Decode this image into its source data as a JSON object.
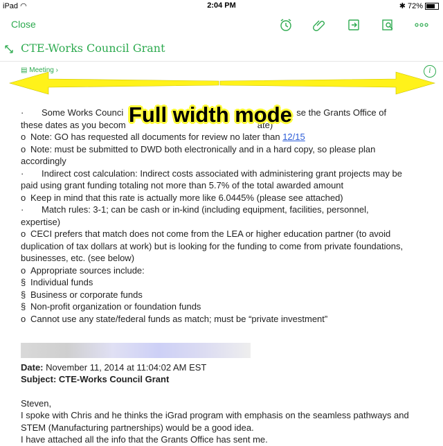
{
  "status": {
    "carrier": "iPad",
    "time": "2:04 PM",
    "battery": "72%"
  },
  "toolbar": {
    "close_label": "Close",
    "icons": [
      "alarm-clock-icon",
      "paperclip-icon",
      "share-icon",
      "presentation-icon",
      "more-icon"
    ]
  },
  "note": {
    "title": "CTE-Works Council Grant",
    "notebook": "Meeting"
  },
  "overlay": {
    "banner": "Full width mode"
  },
  "body": {
    "l1": "Some Works Counci",
    "l1b": "se the Grants Office of",
    "l2": "these dates as you becom",
    "l2b": "ate)",
    "l3a": "Note: GO has requested all documents for review no later than ",
    "l3link": "12/15",
    "l4": "Note: must be submitted to DWD both electronically and in a hard copy, so please plan",
    "l5": "accordingly",
    "l6": "Indirect cost calculation: Indirect costs associated with administering grant projects may be",
    "l7": "paid using grant funding totaling not more than 5.7% of the total awarded amount",
    "l8": "Keep in mind that this rate is actually more like 6.0445% (please see attached)",
    "l9": "Match rules: 3-1; can be cash or in-kind (including equipment, facilities, personnel,",
    "l10": "expertise)",
    "l11": "CECI prefers that match does not come from the LEA or higher education partner (to avoid",
    "l12": "duplication of tax dollars at work) but is looking for the funding to come from private foundations,",
    "l13": "businesses, etc. (see below)",
    "l14": "Appropriate sources include:",
    "l15": "Individual funds",
    "l16": "Business or corporate funds",
    "l17": "Non-profit organization or foundation funds",
    "l18": "Cannot use any state/federal funds as match; must be “private investment”",
    "date_label": "Date:",
    "date_value": "November 11, 2014 at 11:04:02 AM EST",
    "subject_label": "Subject:",
    "subject_value": "CTE-Works Council Grant",
    "greeting": "Steven,",
    "p1": "I spoke with Chris and he thinks the iGrad program with emphasis on the seamless pathways and",
    "p2": "STEM (Manufacturing partnerships) would be a good idea.",
    "p3": "I have attached all the info that the Grants Office has sent me."
  },
  "bullets": {
    "dot": "·",
    "o": "o",
    "s": "§"
  }
}
